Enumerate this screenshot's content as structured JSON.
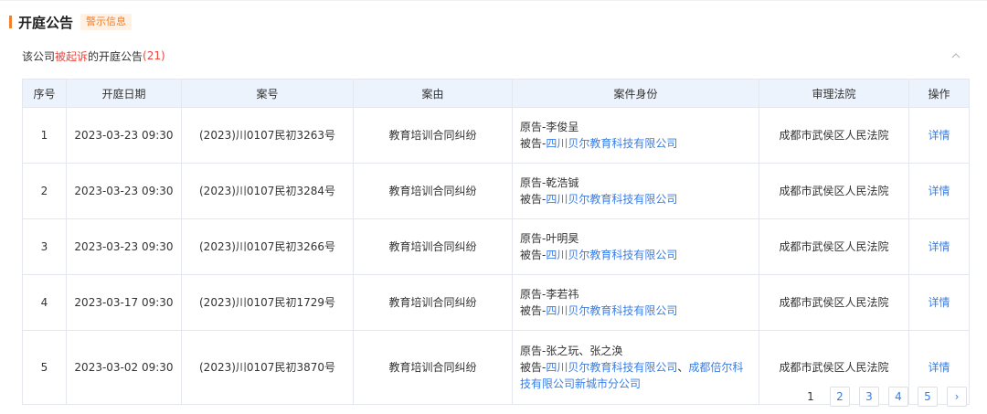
{
  "section": {
    "title": "开庭公告",
    "badge": "警示信息"
  },
  "subheader": {
    "prefix": "该公司",
    "highlight": "被起诉",
    "suffix": "的开庭公告",
    "count": "(21)"
  },
  "table": {
    "columns": [
      "序号",
      "开庭日期",
      "案号",
      "案由",
      "案件身份",
      "审理法院",
      "操作"
    ],
    "rows": [
      {
        "index": "1",
        "date": "2023-03-23 09:30",
        "case_no": "(2023)川0107民初3263号",
        "cause": "教育培训合同纠纷",
        "plaintiff": "原告-李俊呈",
        "defendant_prefix": "被告-",
        "defendant_link": "四川贝尔教育科技有限公司",
        "court": "成都市武侯区人民法院",
        "action": "详情"
      },
      {
        "index": "2",
        "date": "2023-03-23 09:30",
        "case_no": "(2023)川0107民初3284号",
        "cause": "教育培训合同纠纷",
        "plaintiff": "原告-乾浩铖",
        "defendant_prefix": "被告-",
        "defendant_link": "四川贝尔教育科技有限公司",
        "court": "成都市武侯区人民法院",
        "action": "详情"
      },
      {
        "index": "3",
        "date": "2023-03-23 09:30",
        "case_no": "(2023)川0107民初3266号",
        "cause": "教育培训合同纠纷",
        "plaintiff": "原告-叶明昊",
        "defendant_prefix": "被告-",
        "defendant_link": "四川贝尔教育科技有限公司",
        "court": "成都市武侯区人民法院",
        "action": "详情"
      },
      {
        "index": "4",
        "date": "2023-03-17 09:30",
        "case_no": "(2023)川0107民初1729号",
        "cause": "教育培训合同纠纷",
        "plaintiff": "原告-李若祎",
        "defendant_prefix": "被告-",
        "defendant_link": "四川贝尔教育科技有限公司",
        "court": "成都市武侯区人民法院",
        "action": "详情"
      },
      {
        "index": "5",
        "date": "2023-03-02 09:30",
        "case_no": "(2023)川0107民初3870号",
        "cause": "教育培训合同纠纷",
        "plaintiff": "原告-张之玩、张之涣",
        "defendant_prefix": "被告-",
        "defendant_link": "四川贝尔教育科技有限公司",
        "defendant_sep": "、",
        "defendant_link2": "成都倍尔科技有限公司新城市分公司",
        "court": "成都市武侯区人民法院",
        "action": "详情"
      }
    ]
  },
  "pagination": {
    "current": "1",
    "pages": [
      "2",
      "3",
      "4",
      "5"
    ],
    "next": "›"
  },
  "colors": {
    "accent": "#f0802b",
    "link": "#3a7ee5",
    "danger": "#e8473f",
    "header_bg": "#ecf3fd"
  },
  "icons": {
    "collapse": "chevron-up-icon",
    "next": "chevron-right-icon"
  }
}
